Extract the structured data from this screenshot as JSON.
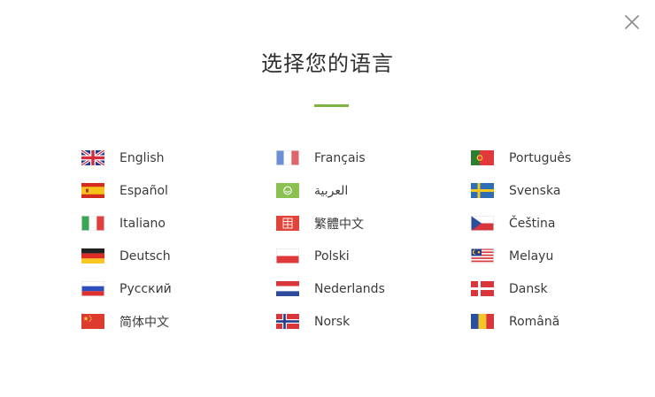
{
  "dialog": {
    "title": "选择您的语言",
    "close_icon": "close-icon",
    "accent_color": "#7cb342"
  },
  "languages": [
    {
      "label": "English",
      "flag": "uk-flag-icon"
    },
    {
      "label": "Español",
      "flag": "spain-flag-icon"
    },
    {
      "label": "Italiano",
      "flag": "italy-flag-icon"
    },
    {
      "label": "Deutsch",
      "flag": "germany-flag-icon"
    },
    {
      "label": "Русский",
      "flag": "russia-flag-icon"
    },
    {
      "label": "简体中文",
      "flag": "china-flag-icon"
    },
    {
      "label": "Français",
      "flag": "france-flag-icon"
    },
    {
      "label": "العربية",
      "flag": "arabic-flag-icon"
    },
    {
      "label": "繁體中文",
      "flag": "traditional-chinese-flag-icon"
    },
    {
      "label": "Polski",
      "flag": "poland-flag-icon"
    },
    {
      "label": "Nederlands",
      "flag": "netherlands-flag-icon"
    },
    {
      "label": "Norsk",
      "flag": "norway-flag-icon"
    },
    {
      "label": "Português",
      "flag": "portugal-flag-icon"
    },
    {
      "label": "Svenska",
      "flag": "sweden-flag-icon"
    },
    {
      "label": "Čeština",
      "flag": "czech-flag-icon"
    },
    {
      "label": "Melayu",
      "flag": "malaysia-flag-icon"
    },
    {
      "label": "Dansk",
      "flag": "denmark-flag-icon"
    },
    {
      "label": "Română",
      "flag": "romania-flag-icon"
    }
  ]
}
